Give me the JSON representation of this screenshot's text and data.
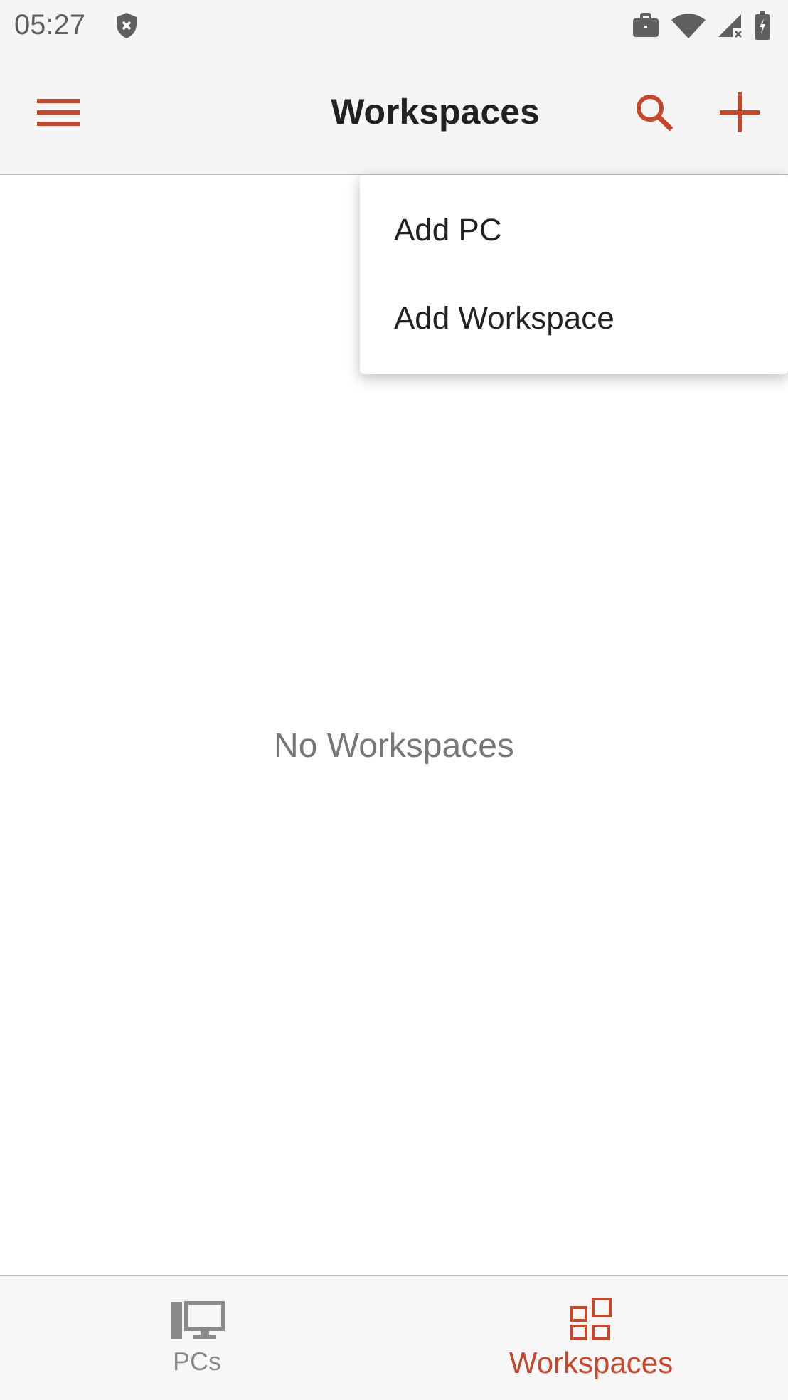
{
  "status_bar": {
    "time": "05:27"
  },
  "app_bar": {
    "title": "Workspaces"
  },
  "menu": {
    "items": [
      "Add PC",
      "Add Workspace"
    ]
  },
  "empty_message": "No Workspaces",
  "bottom_tabs": [
    {
      "label": "PCs",
      "selected": false
    },
    {
      "label": "Workspaces",
      "selected": true
    }
  ]
}
